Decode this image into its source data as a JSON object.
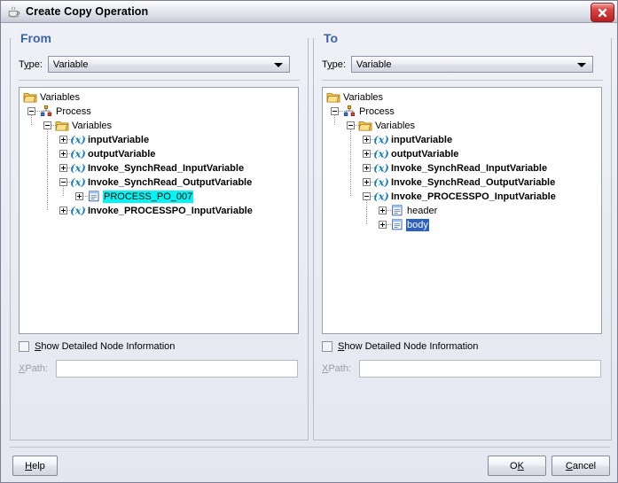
{
  "window": {
    "title": "Create Copy Operation",
    "title_icon": "java-coffee-cup-icon",
    "close_icon": "close-x-icon"
  },
  "panels": [
    {
      "id": "from",
      "legend": "From",
      "type_label_pre": "T",
      "type_label_mn": "y",
      "type_label_post": "pe:",
      "type_value": "Variable",
      "checkbox_label_mn": "S",
      "checkbox_label_post": "how Detailed Node Information",
      "checkbox_checked": false,
      "xpath_label_mn": "X",
      "xpath_label_post": "Path:",
      "xpath_value": "",
      "tree": [
        {
          "depth": 0,
          "label": "Variables",
          "icon": "folder-icon",
          "toggle": "none",
          "bold": false,
          "selected": "none"
        },
        {
          "depth": 1,
          "label": "Process",
          "icon": "process-icon",
          "toggle": "minus",
          "bold": false,
          "selected": "none"
        },
        {
          "depth": 2,
          "label": "Variables",
          "icon": "folder-icon",
          "toggle": "minus",
          "bold": false,
          "selected": "none"
        },
        {
          "depth": 3,
          "label": "inputVariable",
          "icon": "variable-icon",
          "toggle": "plus",
          "bold": true,
          "selected": "none"
        },
        {
          "depth": 3,
          "label": "outputVariable",
          "icon": "variable-icon",
          "toggle": "plus",
          "bold": true,
          "selected": "none"
        },
        {
          "depth": 3,
          "label": "Invoke_SynchRead_InputVariable",
          "icon": "variable-icon",
          "toggle": "plus",
          "bold": true,
          "selected": "none"
        },
        {
          "depth": 3,
          "label": "Invoke_SynchRead_OutputVariable",
          "icon": "variable-icon",
          "toggle": "minus",
          "bold": true,
          "selected": "none"
        },
        {
          "depth": 4,
          "label": "PROCESS_PO_007",
          "icon": "element-icon",
          "toggle": "plus",
          "bold": false,
          "selected": "cyan"
        },
        {
          "depth": 3,
          "label": "Invoke_PROCESSPO_InputVariable",
          "icon": "variable-icon",
          "toggle": "plus",
          "bold": true,
          "selected": "none"
        }
      ]
    },
    {
      "id": "to",
      "legend": "To",
      "type_label_pre": "T",
      "type_label_mn": "y",
      "type_label_post": "pe:",
      "type_value": "Variable",
      "checkbox_label_mn": "S",
      "checkbox_label_post": "how Detailed Node Information",
      "checkbox_checked": false,
      "xpath_label_mn": "X",
      "xpath_label_post": "Path:",
      "xpath_value": "",
      "tree": [
        {
          "depth": 0,
          "label": "Variables",
          "icon": "folder-icon",
          "toggle": "none",
          "bold": false,
          "selected": "none"
        },
        {
          "depth": 1,
          "label": "Process",
          "icon": "process-icon",
          "toggle": "minus",
          "bold": false,
          "selected": "none"
        },
        {
          "depth": 2,
          "label": "Variables",
          "icon": "folder-icon",
          "toggle": "minus",
          "bold": false,
          "selected": "none"
        },
        {
          "depth": 3,
          "label": "inputVariable",
          "icon": "variable-icon",
          "toggle": "plus",
          "bold": true,
          "selected": "none"
        },
        {
          "depth": 3,
          "label": "outputVariable",
          "icon": "variable-icon",
          "toggle": "plus",
          "bold": true,
          "selected": "none"
        },
        {
          "depth": 3,
          "label": "Invoke_SynchRead_InputVariable",
          "icon": "variable-icon",
          "toggle": "plus",
          "bold": true,
          "selected": "none"
        },
        {
          "depth": 3,
          "label": "Invoke_SynchRead_OutputVariable",
          "icon": "variable-icon",
          "toggle": "plus",
          "bold": true,
          "selected": "none"
        },
        {
          "depth": 3,
          "label": "Invoke_PROCESSPO_InputVariable",
          "icon": "variable-icon",
          "toggle": "minus",
          "bold": true,
          "selected": "none"
        },
        {
          "depth": 4,
          "label": "header",
          "icon": "element-icon",
          "toggle": "plus",
          "bold": false,
          "selected": "none"
        },
        {
          "depth": 4,
          "label": "body",
          "icon": "element-icon",
          "toggle": "plus",
          "bold": false,
          "selected": "blue"
        }
      ]
    }
  ],
  "footer": {
    "help_mn": "H",
    "help_post": "elp",
    "ok_pre": "O",
    "ok_mn": "K",
    "cancel_mn": "C",
    "cancel_post": "ancel"
  },
  "colors": {
    "legend": "#3a63a8",
    "selection_inactive": "#00f5f5",
    "selection_active": "#2b5fc4",
    "dialog_bg": "#eef0f6",
    "close_red": "#b81f1f"
  }
}
